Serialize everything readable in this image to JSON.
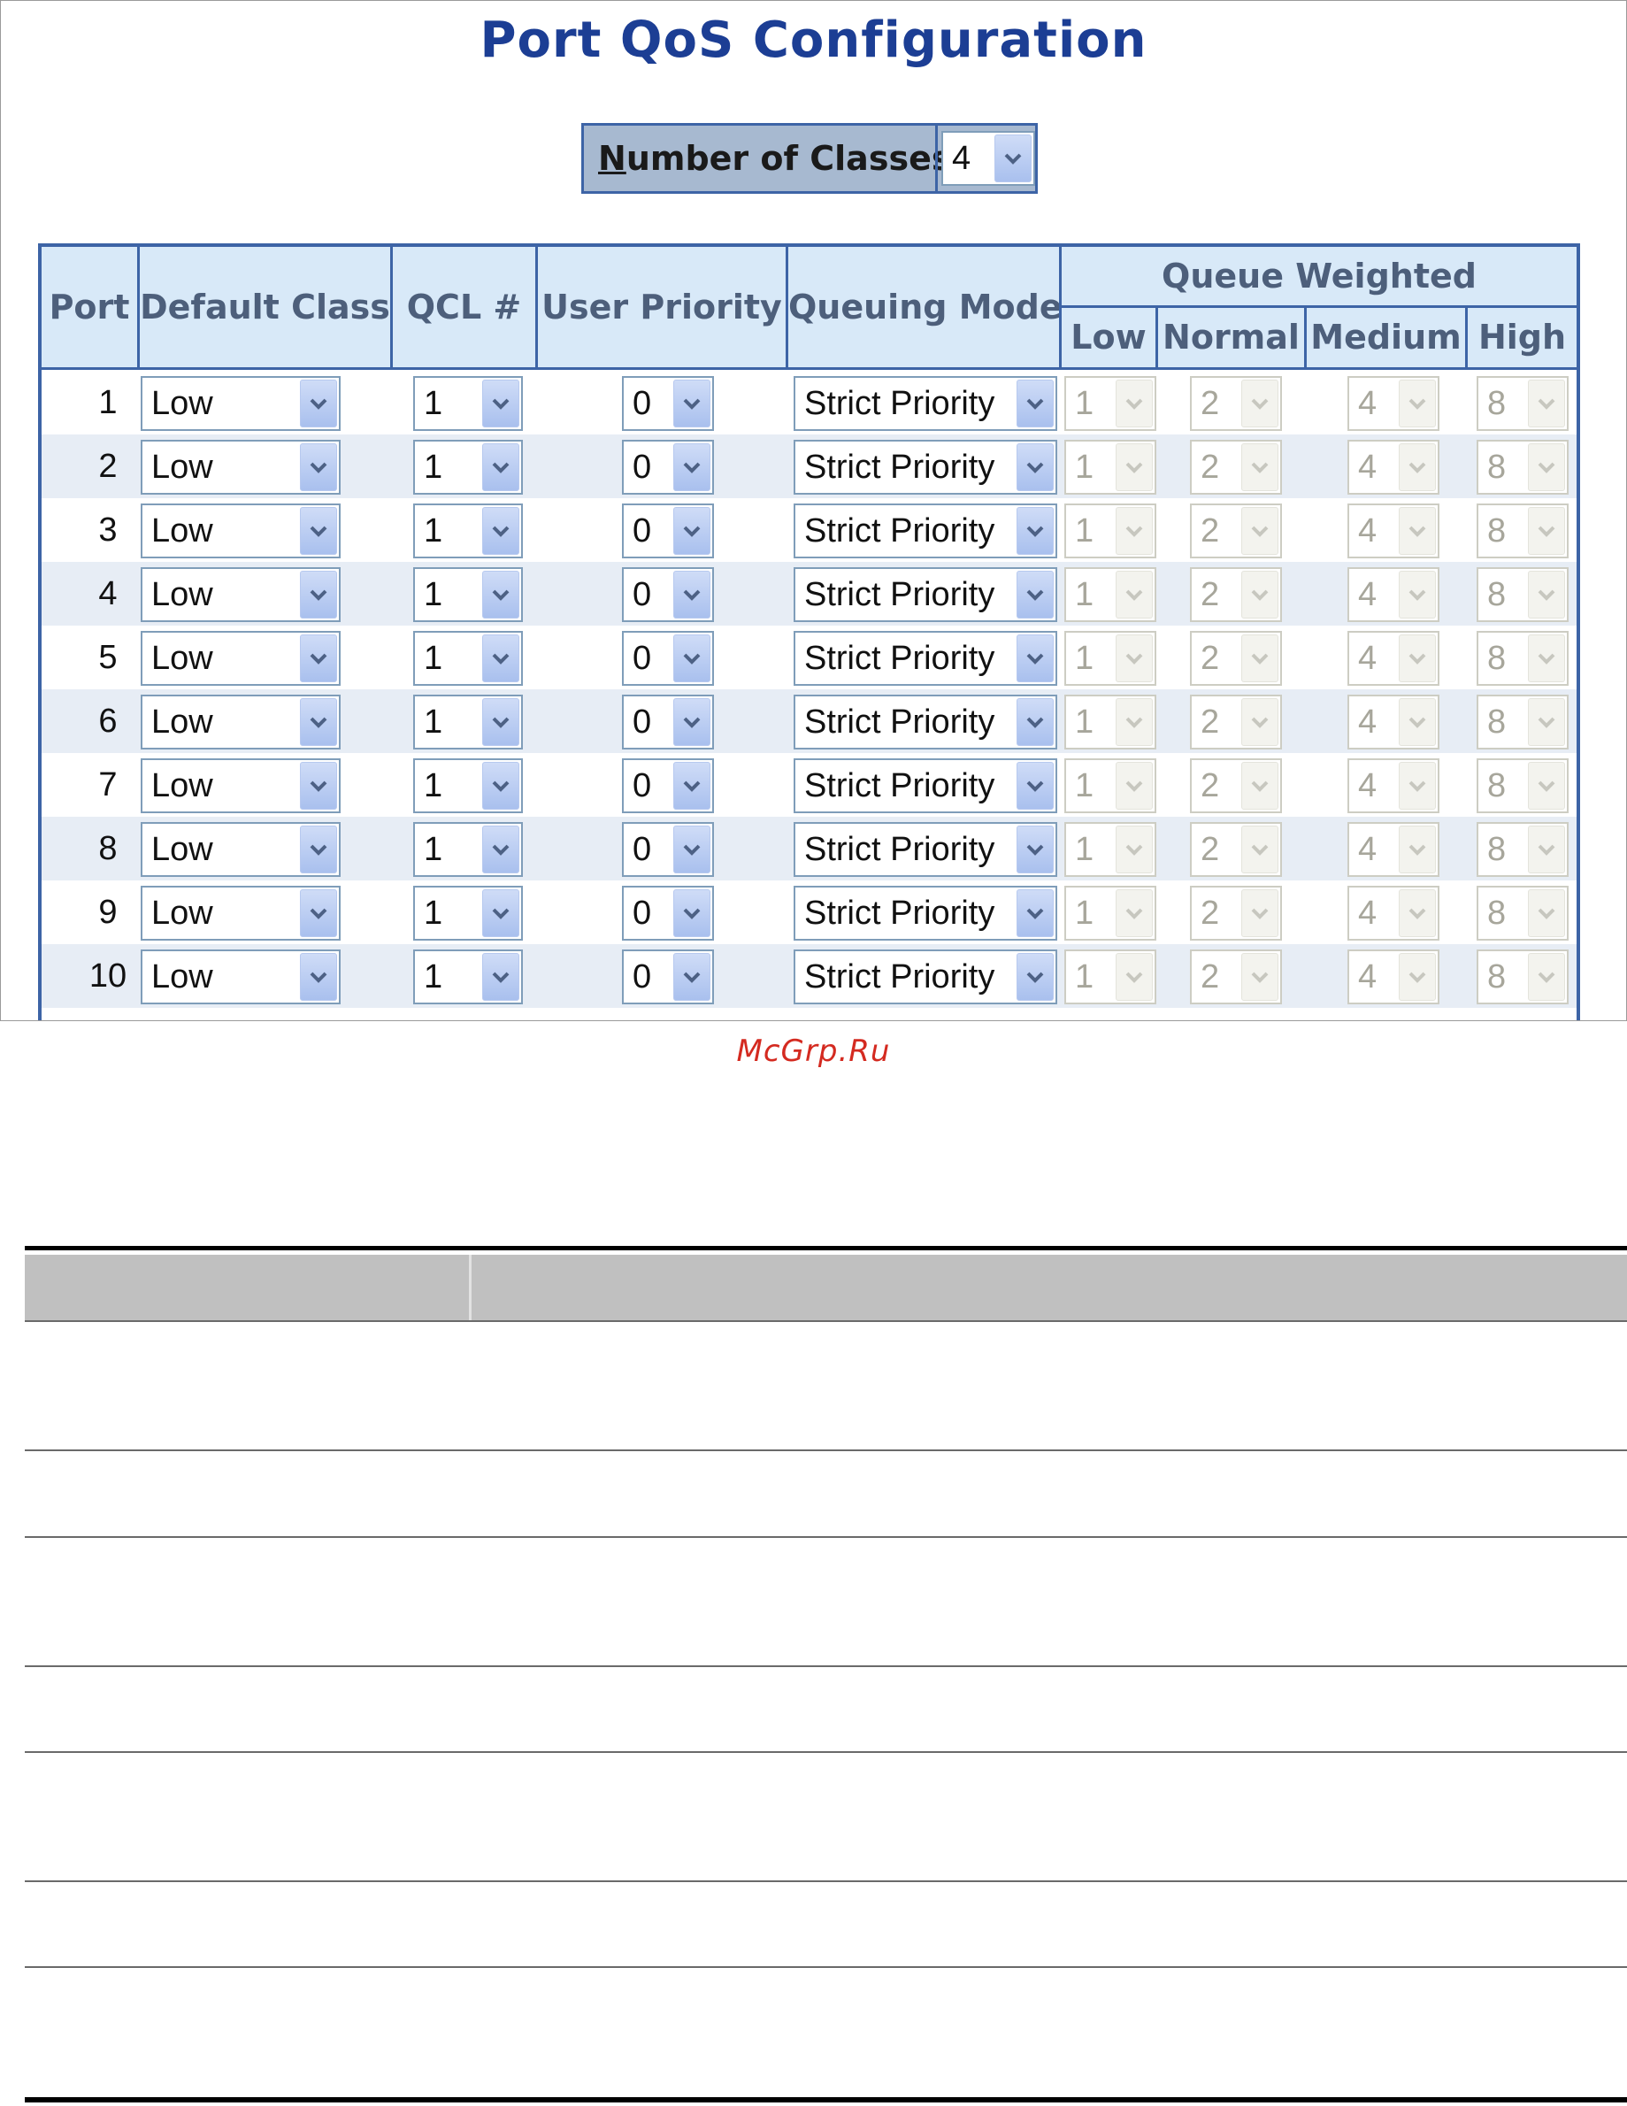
{
  "page": {
    "title": "Port QoS Configuration",
    "number_of_classes": {
      "label_first": "N",
      "label_rest": "umber of Classes",
      "value": "4"
    }
  },
  "table": {
    "headers": {
      "port": "Port",
      "default_class": "Default Class",
      "qcl": "QCL #",
      "user_priority": "User Priority",
      "queuing_mode": "Queuing Mode",
      "queue_weighted": "Queue Weighted",
      "low": "Low",
      "normal": "Normal",
      "medium": "Medium",
      "high": "High"
    },
    "rows": [
      {
        "port": "1",
        "default_class": "Low",
        "qcl": "1",
        "user_priority": "0",
        "queuing_mode": "Strict Priority",
        "w_low": "1",
        "w_normal": "2",
        "w_medium": "4",
        "w_high": "8"
      },
      {
        "port": "2",
        "default_class": "Low",
        "qcl": "1",
        "user_priority": "0",
        "queuing_mode": "Strict Priority",
        "w_low": "1",
        "w_normal": "2",
        "w_medium": "4",
        "w_high": "8"
      },
      {
        "port": "3",
        "default_class": "Low",
        "qcl": "1",
        "user_priority": "0",
        "queuing_mode": "Strict Priority",
        "w_low": "1",
        "w_normal": "2",
        "w_medium": "4",
        "w_high": "8"
      },
      {
        "port": "4",
        "default_class": "Low",
        "qcl": "1",
        "user_priority": "0",
        "queuing_mode": "Strict Priority",
        "w_low": "1",
        "w_normal": "2",
        "w_medium": "4",
        "w_high": "8"
      },
      {
        "port": "5",
        "default_class": "Low",
        "qcl": "1",
        "user_priority": "0",
        "queuing_mode": "Strict Priority",
        "w_low": "1",
        "w_normal": "2",
        "w_medium": "4",
        "w_high": "8"
      },
      {
        "port": "6",
        "default_class": "Low",
        "qcl": "1",
        "user_priority": "0",
        "queuing_mode": "Strict Priority",
        "w_low": "1",
        "w_normal": "2",
        "w_medium": "4",
        "w_high": "8"
      },
      {
        "port": "7",
        "default_class": "Low",
        "qcl": "1",
        "user_priority": "0",
        "queuing_mode": "Strict Priority",
        "w_low": "1",
        "w_normal": "2",
        "w_medium": "4",
        "w_high": "8"
      },
      {
        "port": "8",
        "default_class": "Low",
        "qcl": "1",
        "user_priority": "0",
        "queuing_mode": "Strict Priority",
        "w_low": "1",
        "w_normal": "2",
        "w_medium": "4",
        "w_high": "8"
      },
      {
        "port": "9",
        "default_class": "Low",
        "qcl": "1",
        "user_priority": "0",
        "queuing_mode": "Strict Priority",
        "w_low": "1",
        "w_normal": "2",
        "w_medium": "4",
        "w_high": "8"
      },
      {
        "port": "10",
        "default_class": "Low",
        "qcl": "1",
        "user_priority": "0",
        "queuing_mode": "Strict Priority",
        "w_low": "1",
        "w_normal": "2",
        "w_medium": "4",
        "w_high": "8"
      }
    ]
  },
  "watermark": "McGrp.Ru",
  "colors": {
    "title": "#1c3e94",
    "border": "#3d64a6",
    "header_bg": "#d8e9f8",
    "header_text": "#4d5f7b",
    "row_alt": "#e7edf5",
    "watermark": "#d42a20",
    "doc_header": "#c0c0c0"
  },
  "icons": {
    "dropdown": "chevron-down-icon"
  }
}
